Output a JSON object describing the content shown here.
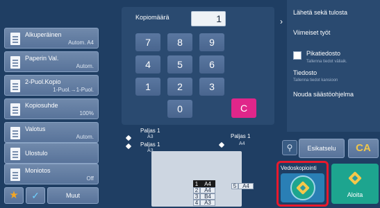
{
  "left_panel": {
    "items": [
      {
        "label": "Alkuperäinen",
        "value": "Autom. A4"
      },
      {
        "label": "Paperin Val.",
        "value": "Autom."
      },
      {
        "label": "2-Puol.Kopio",
        "value": "1-Puol.→1-Puol."
      },
      {
        "label": "Kopiosuhde",
        "value": "100%"
      },
      {
        "label": "Valotus",
        "value": "Autom."
      },
      {
        "label": "Ulostulo",
        "value": ""
      },
      {
        "label": "Moniotos",
        "value": "Off"
      }
    ],
    "bottom": {
      "star": "★",
      "check": "✓",
      "muut": "Muut"
    }
  },
  "keypad": {
    "copy_label": "Kopiomäärä",
    "copy_value": "1",
    "keys": [
      "7",
      "8",
      "9",
      "4",
      "5",
      "6",
      "1",
      "2",
      "3",
      "0"
    ],
    "clear": "C"
  },
  "right_menu": {
    "chevron": "›",
    "send_print": "Lähetä sekä tulosta",
    "recent_jobs": "Viimeiset työt",
    "quick_file": "Pikatiedosto",
    "quick_file_sub": "Tallenna tiedot väliaik.",
    "file": "Tiedosto",
    "file_sub": "Tallenna tiedot kansioon",
    "recall": "Nouda säästöohjelma"
  },
  "preview": {
    "label": "Esikatselu",
    "ca": "CA"
  },
  "start": {
    "proof_label": "Vedoskopiointi",
    "start_label": "Aloita"
  },
  "machine": {
    "top_left_label": "Paljas 1",
    "top_left_sub": "A3",
    "mid_left_label": "Paljas 1",
    "mid_left_sub": "A3",
    "right_label": "Paljas 1",
    "right_sub": "A4",
    "trays": [
      {
        "num": "1",
        "size": "A4"
      },
      {
        "num": "2",
        "size": "A4"
      },
      {
        "num": "3",
        "size": "B4"
      },
      {
        "num": "4",
        "size": "A3"
      },
      {
        "num": "5",
        "size": "A4"
      }
    ]
  }
}
